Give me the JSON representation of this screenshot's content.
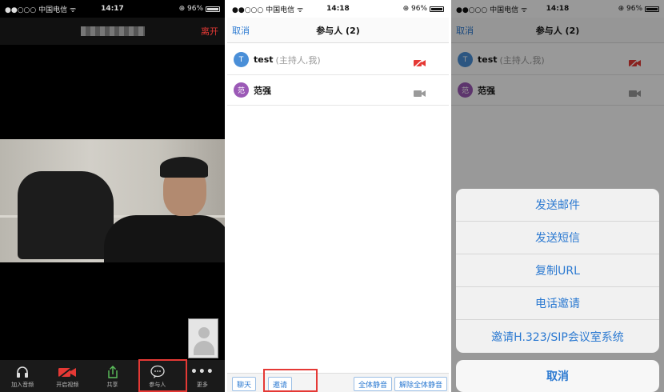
{
  "screen1": {
    "status": {
      "carrier": "●●○○○ 中国电信 ᯤ",
      "time": "14:17",
      "battery": "⊕ 96%"
    },
    "header": {
      "leave_label": "离开"
    },
    "toolbar": {
      "items": [
        {
          "label": "加入音频",
          "icon": "headphones-icon"
        },
        {
          "label": "开启视频",
          "icon": "video-off-icon"
        },
        {
          "label": "共享",
          "icon": "share-icon"
        },
        {
          "label": "参与人",
          "icon": "participants-icon"
        },
        {
          "label": "更多",
          "icon": "more-icon"
        }
      ]
    }
  },
  "screen2": {
    "status": {
      "carrier": "●●○○○ 中国电信 ᯤ",
      "time": "14:18",
      "battery": "⊕ 96%"
    },
    "navbar": {
      "cancel": "取消",
      "title": "参与人 (2)"
    },
    "participants": [
      {
        "avatar": "T",
        "name": "test",
        "role": "(主持人,我)",
        "avatar_color": "#4a8fd8",
        "camera": "video-off-icon"
      },
      {
        "avatar": "范",
        "name": "范强",
        "role": "",
        "avatar_color": "#9b59b6",
        "camera": "video-icon"
      }
    ],
    "bottom": {
      "chat": "聊天",
      "invite": "邀请",
      "mute_all": "全体静音",
      "unmute_all": "解除全体静音"
    }
  },
  "screen3": {
    "status": {
      "carrier": "●●○○○ 中国电信 ᯤ",
      "time": "14:18",
      "battery": "⊕ 96%"
    },
    "navbar": {
      "cancel": "取消",
      "title": "参与人 (2)"
    },
    "participants": [
      {
        "avatar": "T",
        "name": "test",
        "role": "(主持人,我)"
      },
      {
        "avatar": "范",
        "name": "范强",
        "role": ""
      }
    ],
    "sheet": {
      "options": [
        "发送邮件",
        "发送短信",
        "复制URL",
        "电话邀请",
        "邀请H.323/SIP会议室系统"
      ],
      "cancel": "取消"
    }
  },
  "colors": {
    "accent": "#2b79d1",
    "danger": "#e53935"
  }
}
